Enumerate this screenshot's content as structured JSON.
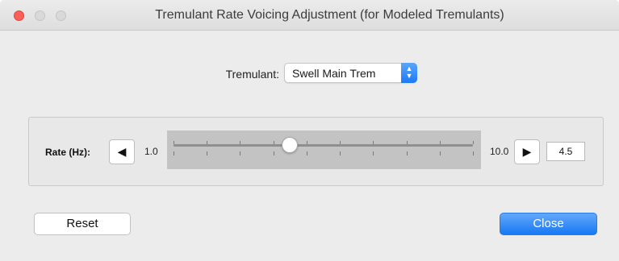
{
  "window": {
    "title": "Tremulant Rate Voicing Adjustment (for Modeled Tremulants)"
  },
  "tremulant": {
    "label": "Tremulant:",
    "selected": "Swell Main Trem"
  },
  "rate": {
    "label": "Rate (Hz):",
    "min_label": "1.0",
    "max_label": "10.0",
    "min": 1.0,
    "max": 10.0,
    "value": 4.5,
    "value_text": "4.5"
  },
  "buttons": {
    "reset_label": "Reset",
    "close_label": "Close"
  },
  "colors": {
    "accent": "#1877f2",
    "close_traffic_light": "#fc5f57"
  },
  "icons": {
    "decrease": "triangle-left-icon",
    "increase": "triangle-right-icon",
    "popup": "chevron-updown-icon"
  }
}
